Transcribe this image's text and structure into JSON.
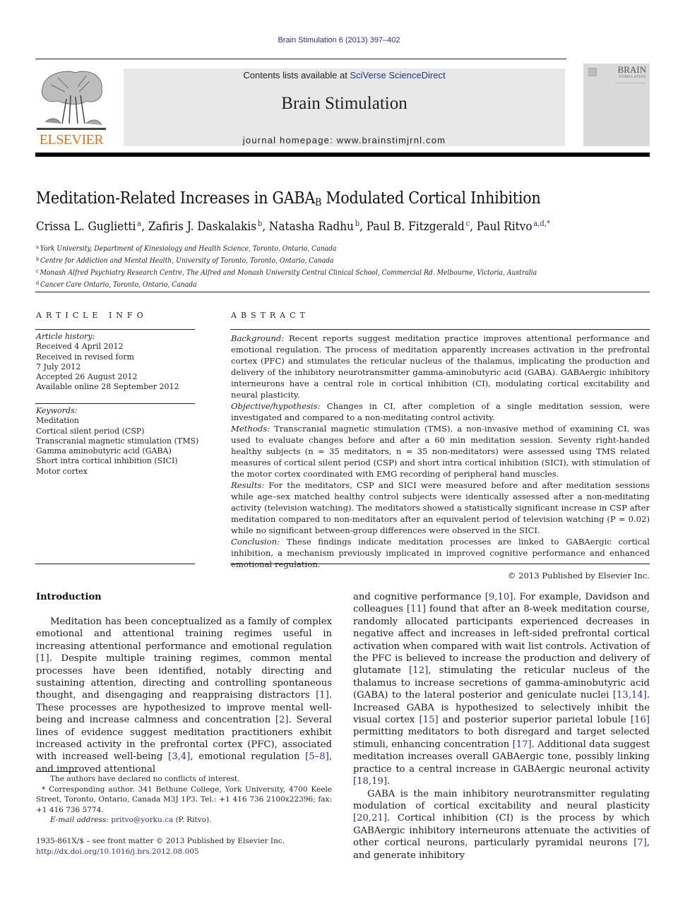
{
  "running_head": "Brain Stimulation 6 (2013) 397–402",
  "header": {
    "publisher": "ELSEVIER",
    "contents_prefix": "Contents lists available at ",
    "contents_link": "SciVerse ScienceDirect",
    "journal_name": "Brain Stimulation",
    "homepage": "journal homepage: www.brainstimjrnl.com",
    "cover_title_1": "BRAIN",
    "cover_title_2": "STIMULATION",
    "colors": {
      "elsevier_orange": "#e9711c",
      "link_blue": "#2b2e8c",
      "banner_gray": "#e8e8e8"
    }
  },
  "article": {
    "title_pre": "Meditation-Related Increases in GABA",
    "title_sub": "B",
    "title_post": " Modulated Cortical Inhibition",
    "authors": [
      {
        "name": "Crissa L. Guglietti",
        "aff": "a",
        "sep": ", "
      },
      {
        "name": "Zafiris J. Daskalakis",
        "aff": "b",
        "sep": ", "
      },
      {
        "name": "Natasha Radhu",
        "aff": "b",
        "sep": ", "
      },
      {
        "name": "Paul B. Fitzgerald",
        "aff": "c",
        "sep": ", "
      },
      {
        "name": "Paul Ritvo",
        "aff": "a,d,*",
        "sep": ""
      }
    ],
    "affiliations": [
      {
        "key": "a",
        "text": "York University, Department of Kinesiology and Health Science, Toronto, Ontario, Canada"
      },
      {
        "key": "b",
        "text": "Centre for Addiction and Mental Health, University of Toronto, Toronto, Ontario, Canada"
      },
      {
        "key": "c",
        "text": "Monash Alfred Psychiatry Research Centre, The Alfred and Monash University Central Clinical School, Commercial Rd. Melbourne, Victoria, Australia"
      },
      {
        "key": "d",
        "text": "Cancer Care Ontario, Toronto, Ontario, Canada"
      }
    ]
  },
  "article_info": {
    "heading": "ARTICLE INFO",
    "history_label": "Article history:",
    "history": [
      "Received 4 April 2012",
      "Received in revised form",
      "7 July 2012",
      "Accepted 26 August 2012",
      "Available online 28 September 2012"
    ],
    "keywords_label": "Keywords:",
    "keywords": [
      "Meditation",
      "Cortical silent period (CSP)",
      "Transcranial magnetic stimulation (TMS)",
      "Gamma aminobutyric acid (GABA)",
      "Short intra cortical inhibition (SICI)",
      "Motor cortex"
    ]
  },
  "abstract": {
    "heading": "ABSTRACT",
    "sections": [
      {
        "label": "Background:",
        "text": " Recent reports suggest meditation practice improves attentional performance and emotional regulation. The process of meditation apparently increases activation in the prefrontal cortex (PFC) and stimulates the reticular nucleus of the thalamus, implicating the production and delivery of the inhibitory neurotransmitter gamma-aminobutyric acid (GABA). GABAergic inhibitory interneurons have a central role in cortical inhibition (CI), modulating cortical excitability and neural plasticity."
      },
      {
        "label": "Objective/hypothesis:",
        "text": " Changes in CI, after completion of a single meditation session, were investigated and compared to a non-meditating control activity."
      },
      {
        "label": "Methods:",
        "text": " Transcranial magnetic stimulation (TMS), a non-invasive method of examining CI, was used to evaluate changes before and after a 60 min meditation session. Seventy right-handed healthy subjects (n = 35 meditators, n = 35 non-meditators) were assessed using TMS related measures of cortical silent period (CSP) and short intra cortical inhibition (SICI), with stimulation of the motor cortex coordinated with EMG recording of peripheral hand muscles."
      },
      {
        "label": "Results:",
        "text": " For the meditators, CSP and SICI were measured before and after meditation sessions while age–sex matched healthy control subjects were identically assessed after a non-meditating activity (television watching). The meditators showed a statistically significant increase in CSP after meditation compared to non-meditators after an equivalent period of television watching (P = 0.02) while no significant between-group differences were observed in the SICI."
      },
      {
        "label": "Conclusion:",
        "text": " These findings indicate meditation processes are linked to GABAergic cortical inhibition, a mechanism previously implicated in improved cognitive performance and enhanced emotional regulation."
      }
    ],
    "copyright": "© 2013 Published by Elsevier Inc."
  },
  "body": {
    "intro_heading": "Introduction",
    "left_col": {
      "p1_a": "Meditation has been conceptualized as a family of complex emotional and attentional training regimes useful in increasing attentional performance and emotional regulation ",
      "c1": "[1]",
      "p1_b": ". Despite multiple training regimes, common mental processes have been identified, notably directing and sustaining attention, directing and controlling spontaneous thought, and disengaging and reappraising distractors ",
      "c2": "[1]",
      "p1_c": ". These processes are hypothesized to improve mental well-being and increase calmness and concentration ",
      "c3": "[2]",
      "p1_d": ". Several lines of evidence suggest meditation practitioners exhibit increased activity in the prefrontal cortex (PFC), associated with increased well-being ",
      "c4": "[3,4]",
      "p1_e": ", emotional regulation ",
      "c5": "[5–8]",
      "p1_f": ", and improved attentional"
    },
    "right_col": {
      "p1_a": "and cognitive performance ",
      "c1": "[9,10]",
      "p1_b": ". For example, Davidson and colleagues ",
      "c2": "[11]",
      "p1_c": " found that after an 8-week meditation course, randomly allocated participants experienced decreases in negative affect and increases in left-sided prefrontal cortical activation when compared with wait list controls. Activation of the PFC is believed to increase the production and delivery of glutamate ",
      "c3": "[12]",
      "p1_d": ", stimulating the reticular nucleus of the thalamus to increase secretions of gamma-aminobutyric acid (GABA) to the lateral posterior and geniculate nuclei ",
      "c4": "[13,14]",
      "p1_e": ". Increased GABA is hypothesized to selectively inhibit the visual cortex ",
      "c5": "[15]",
      "p1_f": " and posterior superior parietal lobule ",
      "c6": "[16]",
      "p1_g": " permitting meditators to both disregard and target selected stimuli, enhancing concentration ",
      "c7": "[17]",
      "p1_h": ". Additional data suggest meditation increases overall GABAergic tone, possibly linking practice to a central increase in GABAergic neuronal activity ",
      "c8": "[18,19]",
      "p1_i": ".",
      "p2_a": "GABA is the main inhibitory neurotransmitter regulating modulation of cortical excitability and neural plasticity ",
      "c9": "[20,21]",
      "p2_b": ". Cortical inhibition (CI) is the process by which GABAergic inhibitory interneurons attenuate the activities of other cortical neurons, particularly pyramidal neurons ",
      "c10": "[7]",
      "p2_c": ", and generate inhibitory"
    }
  },
  "footnotes": {
    "conflict": "The authors have declared no conflicts of interest.",
    "corresponding": "* Corresponding author. 341 Bethune College, York University, 4700 Keele Street, Toronto, Ontario, Canada M3J 1P3. Tel.: +1 416 736 2100x22396; fax: +1 416 736 5774.",
    "email_label": "E-mail address:",
    "email": "pritvo@yorku.ca",
    "email_suffix": " (P. Ritvo).",
    "front_matter": "1935-861X/$ – see front matter © 2013 Published by Elsevier Inc.",
    "doi": "http://dx.doi.org/10.1016/j.brs.2012.08.005"
  }
}
